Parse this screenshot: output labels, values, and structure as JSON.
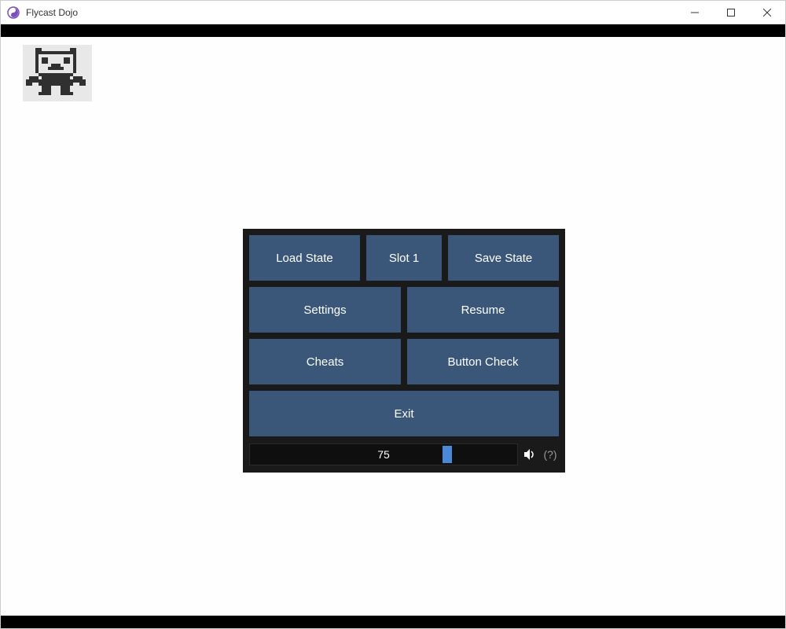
{
  "window": {
    "title": "Flycast Dojo"
  },
  "menu": {
    "load_state": "Load State",
    "slot": "Slot 1",
    "save_state": "Save State",
    "settings": "Settings",
    "resume": "Resume",
    "cheats": "Cheats",
    "button_check": "Button Check",
    "exit": "Exit"
  },
  "slider": {
    "value": "75",
    "percent": 75
  },
  "help": {
    "label": "(?)"
  }
}
